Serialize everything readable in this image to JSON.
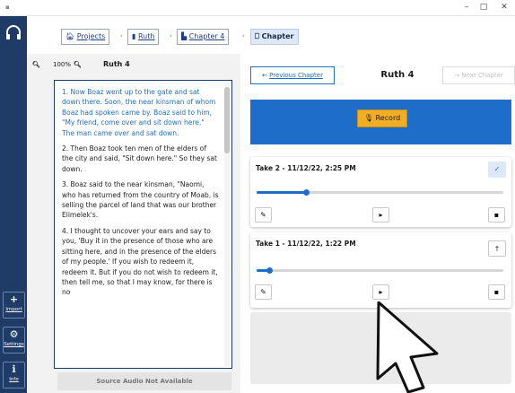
{
  "window": {
    "minimize": "–",
    "maximize": "□",
    "close": "✕"
  },
  "sidebar": {
    "buttons": [
      {
        "icon": "+",
        "label": "Import"
      },
      {
        "icon": "⚙",
        "label": "Settings"
      },
      {
        "icon": "ℹ",
        "label": "Info"
      }
    ]
  },
  "breadcrumbs": {
    "separator": "›",
    "items": [
      {
        "label": "Projects"
      },
      {
        "label": "Ruth"
      },
      {
        "label": "Chapter 4"
      },
      {
        "label": "Chapter"
      }
    ]
  },
  "reader": {
    "zoom": "100%",
    "title": "Ruth 4",
    "verses": [
      "1. Now Boaz went up to the gate and sat down there. Soon, the near kinsman of whom Boaz had spoken came by. Boaz said to him, \"My friend, come over and sit down here.\" The man came over and sat down.",
      "2. Then Boaz took ten men of the elders of the city and said, \"Sit down here.\" So they sat down.",
      "3. Boaz said to the near kinsman, \"Naomi, who has returned from the country of Moab, is selling the parcel of land that was our brother Elimelek's.",
      "4. I thought to uncover your ears and say to you, 'Buy it in the presence of those who are sitting here, and in the presence of the elders of my people.' If you wish to redeem it, redeem it. But if you do not wish to redeem it, then tell me, so that I may know, for there is no"
    ],
    "source_audio": "Source Audio Not Available"
  },
  "chapter_nav": {
    "prev": "Previous Chapter",
    "title": "Ruth 4",
    "next": "Next Chapter"
  },
  "recorder": {
    "record_label": "Record"
  },
  "takes": [
    {
      "title": "Take 2 - 11/12/22, 2:25 PM",
      "progress": 0.2,
      "status": "selected"
    },
    {
      "title": "Take 1 - 11/12/22, 1:22 PM",
      "progress": 0.05,
      "status": "unselected"
    }
  ],
  "colors": {
    "sidebar": "#1f3b68",
    "accent": "#1e6dc9",
    "record_button": "#f3ae25",
    "active_crumb": "#dde9f8"
  }
}
